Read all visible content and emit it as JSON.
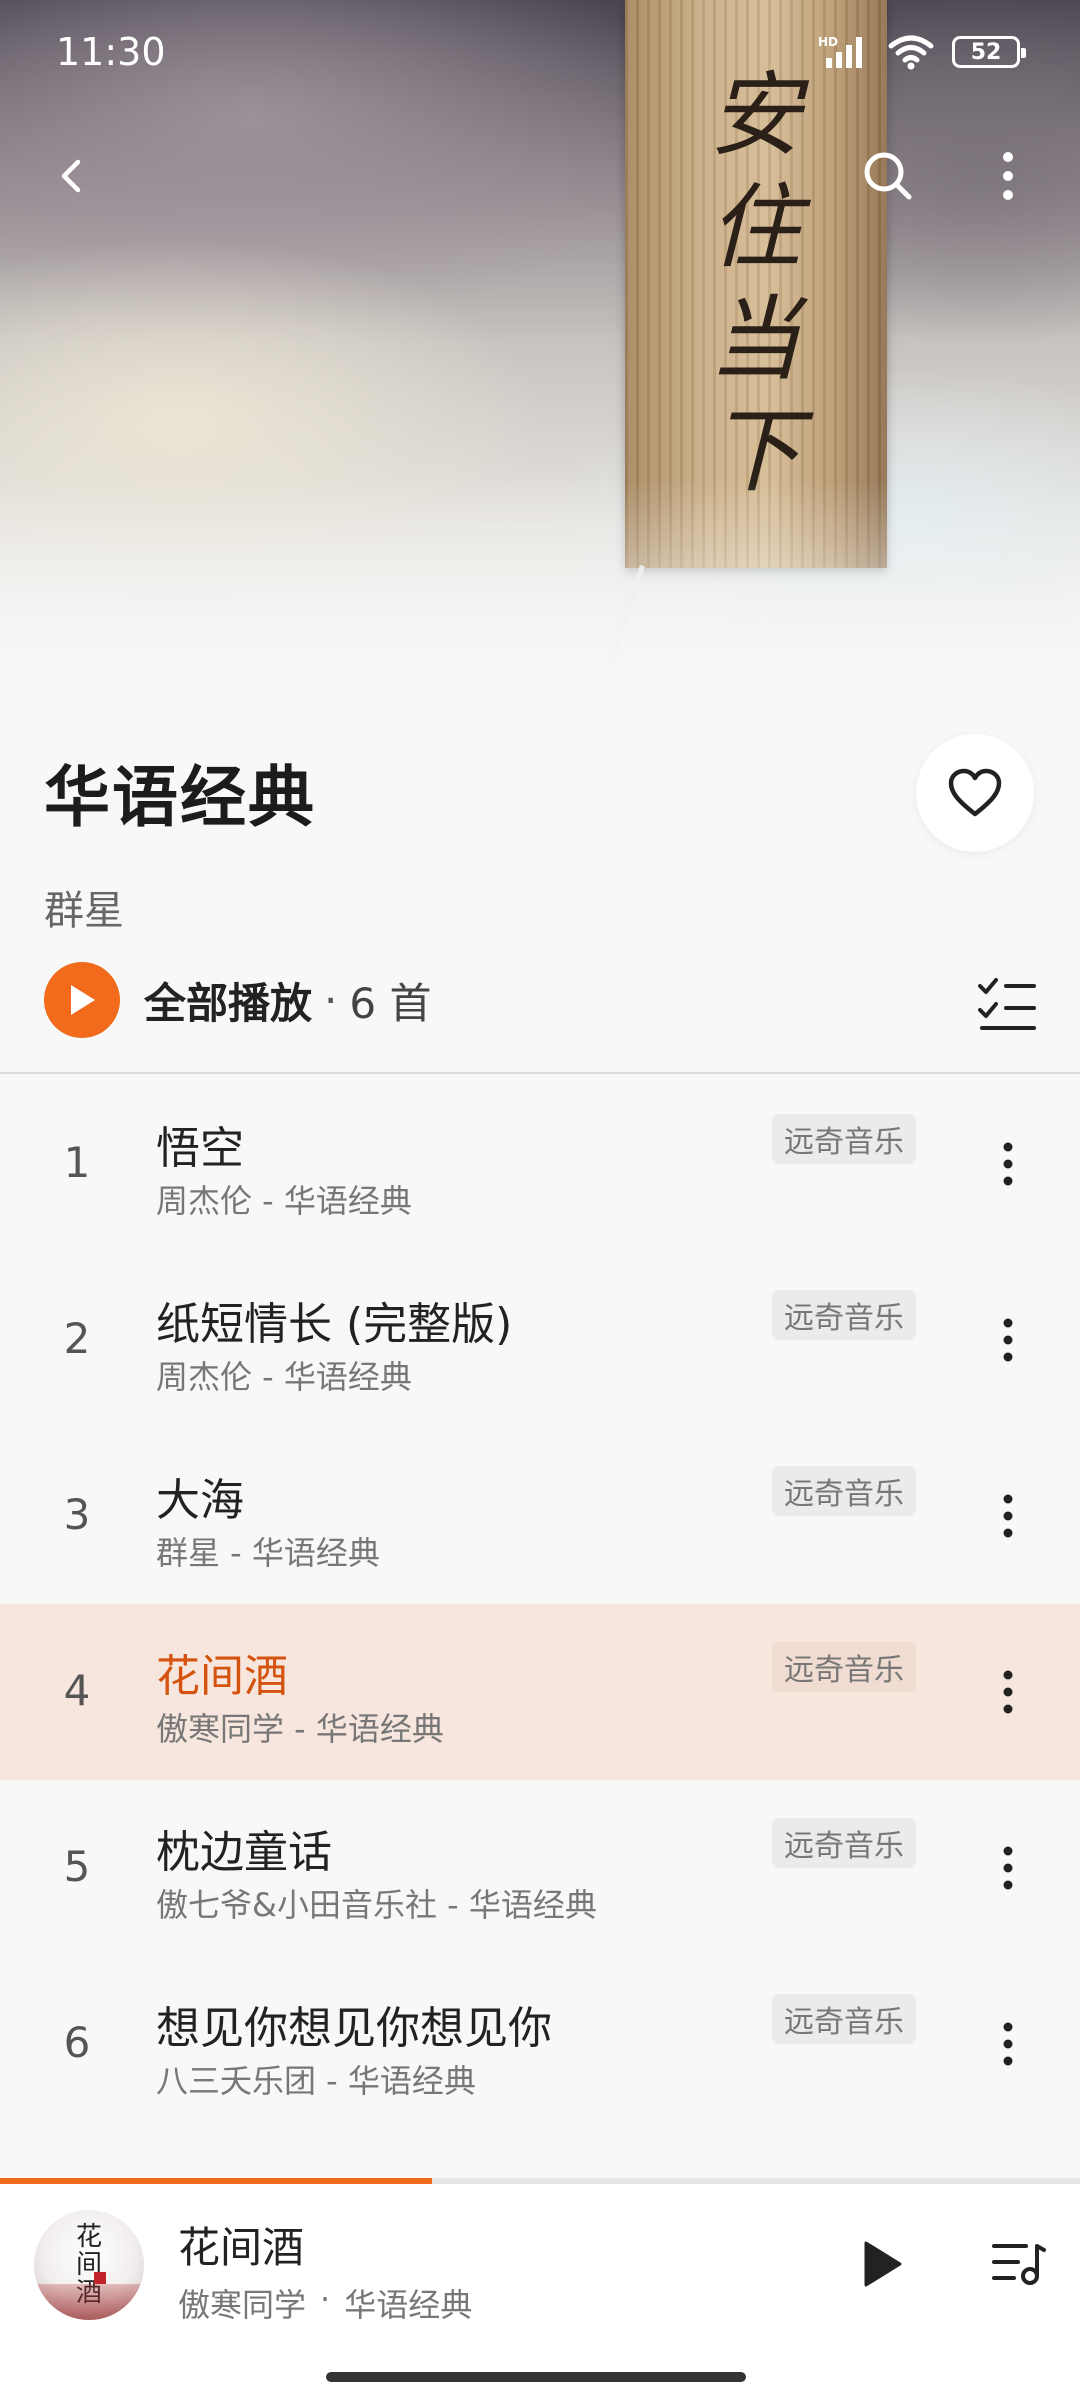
{
  "status_bar": {
    "time": "11:30",
    "network": "HD",
    "battery": "52"
  },
  "header": {
    "back_icon": "chevron-left-icon",
    "search_icon": "search-icon",
    "more_icon": "more-vertical-icon",
    "artwork_text": "安住当下"
  },
  "album": {
    "title": "华语经典",
    "artist": "群星",
    "favorite_icon": "heart-outline-icon"
  },
  "play_all": {
    "label": "全部播放",
    "separator": "·",
    "count": "6 首",
    "accent_color": "#f26b1d"
  },
  "songs": [
    {
      "index": "1",
      "title": "悟空",
      "subtitle": "周杰伦 - 华语经典",
      "source": "远奇音乐",
      "active": false
    },
    {
      "index": "2",
      "title": "纸短情长 (完整版)",
      "subtitle": "周杰伦 - 华语经典",
      "source": "远奇音乐",
      "active": false
    },
    {
      "index": "3",
      "title": "大海",
      "subtitle": "群星 - 华语经典",
      "source": "远奇音乐",
      "active": false
    },
    {
      "index": "4",
      "title": "花间酒",
      "subtitle": "傲寒同学 - 华语经典",
      "source": "远奇音乐",
      "active": true
    },
    {
      "index": "5",
      "title": "枕边童话",
      "subtitle": "傲七爷&小田音乐社 - 华语经典",
      "source": "远奇音乐",
      "active": false
    },
    {
      "index": "6",
      "title": "想见你想见你想见你",
      "subtitle": "八三夭乐团 - 华语经典",
      "source": "远奇音乐",
      "active": false
    }
  ],
  "now_playing": {
    "title": "花间酒",
    "artist": "傲寒同学",
    "dot": "·",
    "album": "华语经典",
    "cover_text": "花间酒",
    "progress": 0.4,
    "play_icon": "play-icon",
    "queue_icon": "playlist-icon"
  }
}
